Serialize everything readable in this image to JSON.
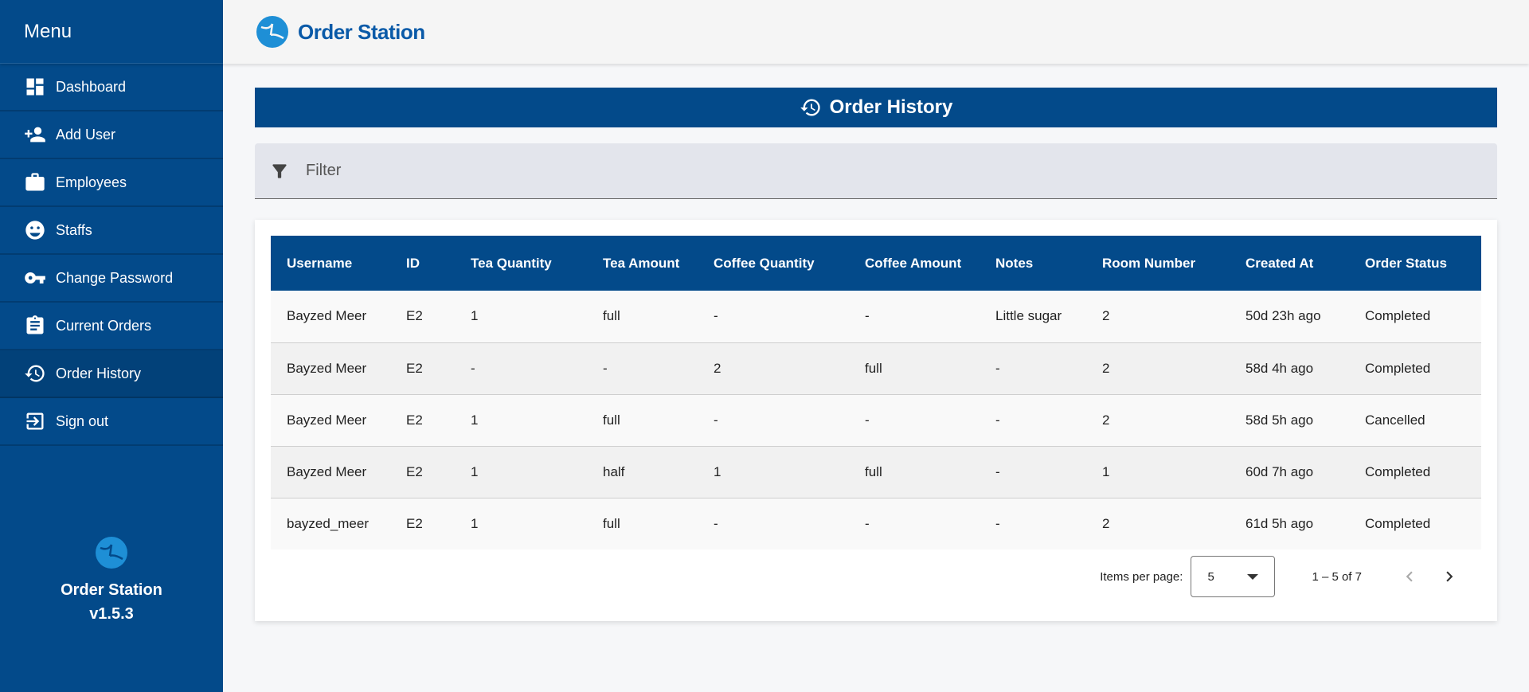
{
  "sidebar": {
    "title": "Menu",
    "items": [
      {
        "label": "Dashboard",
        "icon": "dashboard-icon"
      },
      {
        "label": "Add User",
        "icon": "person-add-icon"
      },
      {
        "label": "Employees",
        "icon": "briefcase-icon"
      },
      {
        "label": "Staffs",
        "icon": "face-icon"
      },
      {
        "label": "Change Password",
        "icon": "key-icon"
      },
      {
        "label": "Current Orders",
        "icon": "clipboard-icon"
      },
      {
        "label": "Order History",
        "icon": "history-icon"
      },
      {
        "label": "Sign out",
        "icon": "sign-out-icon"
      }
    ],
    "active_item": "Order History",
    "footer_name": "Order Station",
    "footer_version": "v1.5.3"
  },
  "header": {
    "app_title": "Order Station"
  },
  "page": {
    "title": "Order History",
    "filter_placeholder": "Filter"
  },
  "table": {
    "columns": [
      "Username",
      "ID",
      "Tea Quantity",
      "Tea Amount",
      "Coffee Quantity",
      "Coffee Amount",
      "Notes",
      "Room Number",
      "Created At",
      "Order Status"
    ],
    "rows": [
      [
        "Bayzed Meer",
        "E2",
        "1",
        "full",
        "-",
        "-",
        "Little sugar",
        "2",
        "50d 23h ago",
        "Completed"
      ],
      [
        "Bayzed Meer",
        "E2",
        "-",
        "-",
        "2",
        "full",
        "-",
        "2",
        "58d 4h ago",
        "Completed"
      ],
      [
        "Bayzed Meer",
        "E2",
        "1",
        "full",
        "-",
        "-",
        "-",
        "2",
        "58d 5h ago",
        "Cancelled"
      ],
      [
        "Bayzed Meer",
        "E2",
        "1",
        "half",
        "1",
        "full",
        "-",
        "1",
        "60d 7h ago",
        "Completed"
      ],
      [
        "bayzed_meer",
        "E2",
        "1",
        "full",
        "-",
        "-",
        "-",
        "2",
        "61d 5h ago",
        "Completed"
      ]
    ]
  },
  "paginator": {
    "items_per_page_label": "Items per page:",
    "items_per_page_value": "5",
    "range_label": "1 – 5 of 7"
  },
  "colors": {
    "primary": "#034a8a",
    "title_blue": "#0a5aa8",
    "logo_blue": "#1e8fd6"
  }
}
